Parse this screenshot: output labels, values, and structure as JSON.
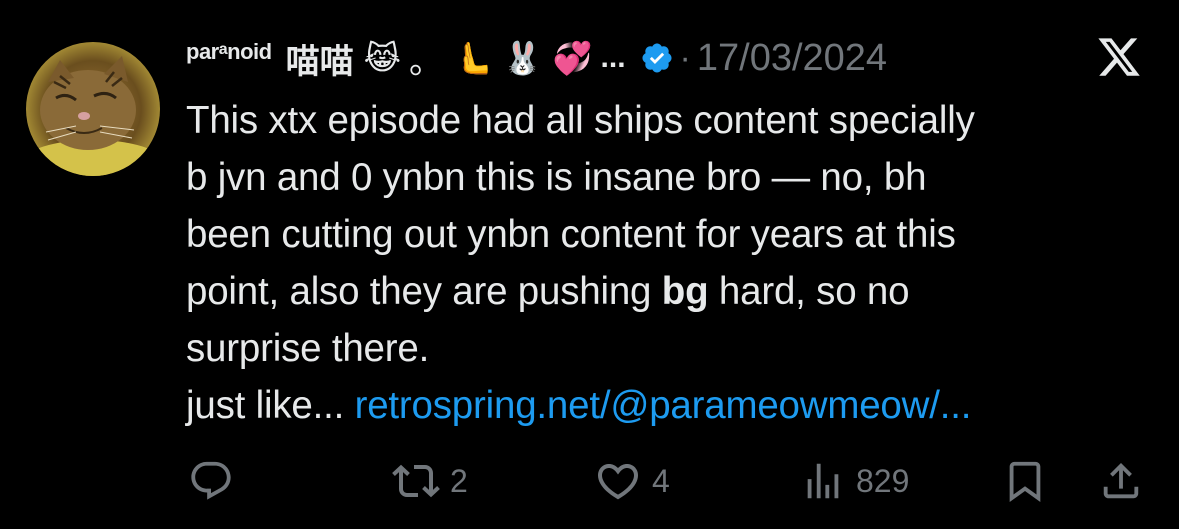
{
  "tweet": {
    "display_name_prefix_a": "par",
    "display_name_prefix_b": "a",
    "display_name_prefix_c": "n",
    "display_name_prefix_d": "oid",
    "display_name_cjk": "喵喵",
    "emoji_1": "😹",
    "separator": "。",
    "emoji_2": "🫷",
    "emoji_3": "🐰",
    "emoji_4": "💞",
    "ellipsis": "...",
    "handle_dot": "·",
    "date": "17/03/2024",
    "verified_icon": "verified-badge-icon",
    "platform_icon": "x-logo-icon",
    "body": {
      "line1": "This xtx episode had all ships content specially",
      "line2": "b jvn and 0 ynbn this is insane bro — no, bh",
      "line3": "been cutting out ynbn content for years at this",
      "line4_a": "point, also they are pushing ",
      "line4_bold": "bg",
      "line4_b": " hard, so no",
      "line5": "surprise there.",
      "line6_a": "just like... ",
      "line6_link": "retrospring.net/@parameowmeow/..."
    },
    "actions": {
      "reply_icon": "reply-icon",
      "retweet_icon": "retweet-icon",
      "retweet_count": "2",
      "like_icon": "heart-icon",
      "like_count": "4",
      "views_icon": "views-icon",
      "views_count": "829",
      "bookmark_icon": "bookmark-icon",
      "share_icon": "share-icon"
    },
    "colors": {
      "background": "#000000",
      "text": "#e7e9ea",
      "muted": "#71767b",
      "link": "#1d9bf0",
      "verified": "#1d9bf0"
    }
  }
}
